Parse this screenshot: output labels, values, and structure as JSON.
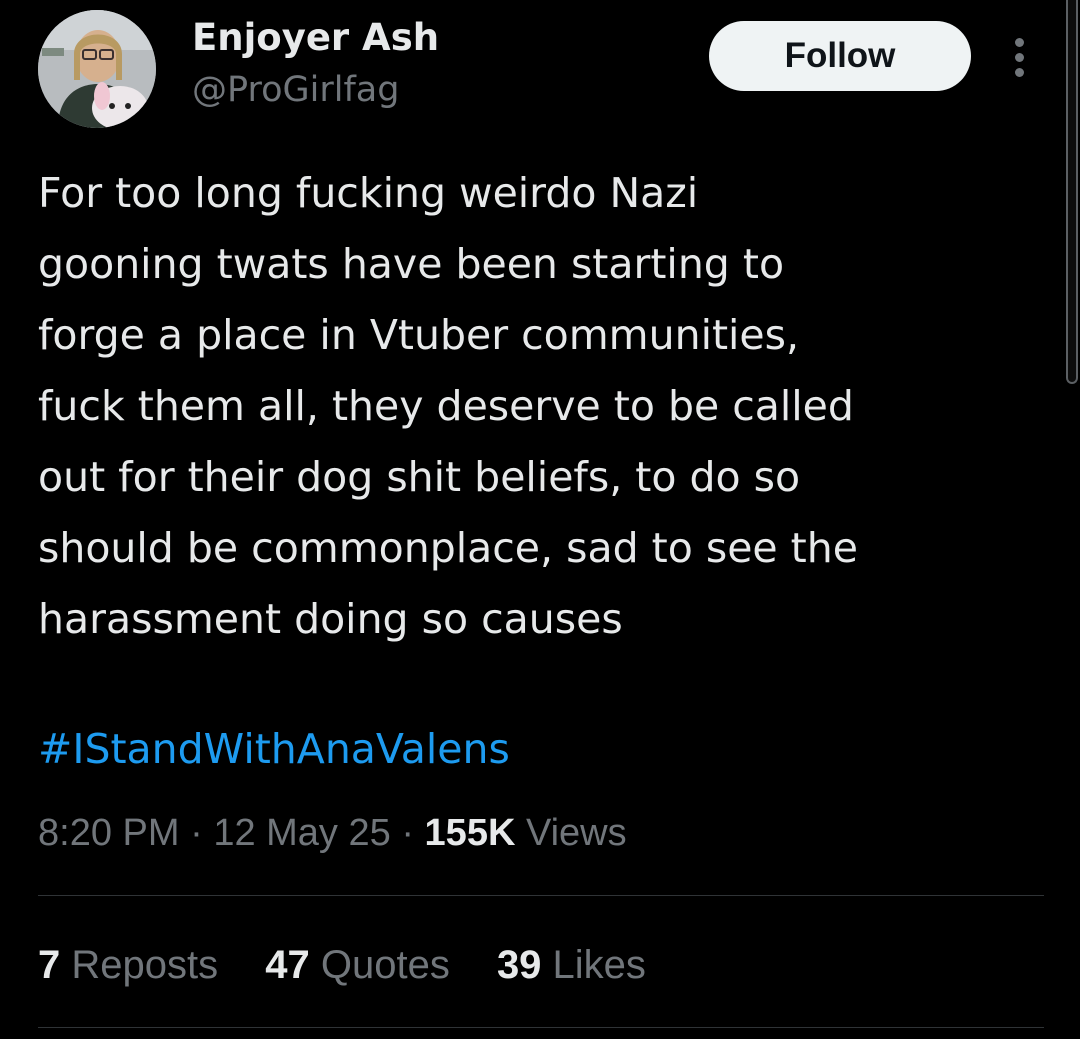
{
  "author": {
    "display_name": "Enjoyer Ash",
    "handle": "@ProGirlfag"
  },
  "follow_label": "Follow",
  "more_icon": "more-vertical-icon",
  "tweet": {
    "lines": [
      "For too long fucking weirdo Nazi",
      "gooning twats have been starting to",
      "forge a place in Vtuber communities,",
      "fuck them all, they deserve to be called",
      "out for their dog shit beliefs, to do so",
      "should be commonplace, sad to see the",
      "harassment doing so causes"
    ],
    "hashtag": "#IStandWithAnaValens"
  },
  "meta": {
    "time": "8:20 PM",
    "separator": " · ",
    "date": "12 May 25",
    "views_count": "155K",
    "views_label": " Views"
  },
  "stats": [
    {
      "count": "7",
      "label": " Reposts"
    },
    {
      "count": "47",
      "label": " Quotes"
    },
    {
      "count": "39",
      "label": " Likes"
    }
  ],
  "colors": {
    "background": "#000000",
    "text": "#e7e9ea",
    "secondary": "#71767b",
    "link": "#1d9bf0",
    "button_bg": "#eff3f4",
    "divider": "#2f3336"
  }
}
